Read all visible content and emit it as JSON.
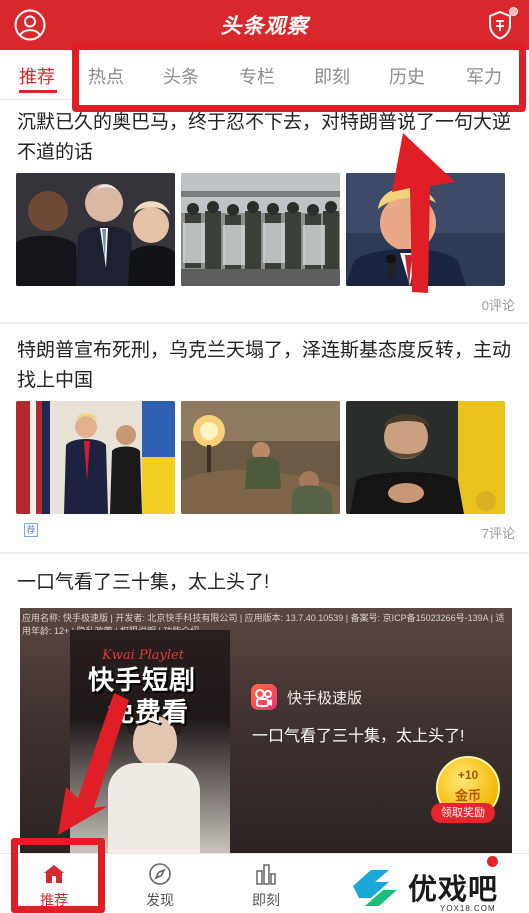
{
  "header": {
    "title": "头条观察",
    "avatar_icon": "user-icon",
    "shield_icon": "shield-icon"
  },
  "tabs": {
    "active": "推荐",
    "items": [
      "热点",
      "头条",
      "专栏",
      "即刻",
      "历史",
      "军力"
    ]
  },
  "articles": [
    {
      "title": "沉默已久的奥巴马，终于忍不下去，对特朗普说了一句大逆不道的话",
      "comments": "0评论"
    },
    {
      "title": "特朗普宣布死刑，乌克兰天塌了，泽连斯基态度反转，主动找上中国",
      "tag": "荐",
      "comments": "7评论"
    },
    {
      "title": "一口气看了三十集，太上头了!"
    }
  ],
  "ad": {
    "info": "应用名称: 快手极速版 | 开发者: 北京快手科技有限公司 | 应用版本: 13.7.40.10539 | 备案号: 京ICP备15023266号-139A | 适用年龄: 12+ | 隐私政策 | 权限说明 | 功能介绍",
    "poster_sub": "Kwai Playlet",
    "poster_title_1": "快手短剧",
    "poster_title_2": "免费看",
    "app_name": "快手极速版",
    "slogan": "一口气看了三十集，太上头了!",
    "coin_amount": "+10",
    "coin_unit": "金币",
    "coin_button": "领取奖励"
  },
  "bottom_nav": [
    {
      "label": "推荐",
      "icon": "home-icon",
      "active": true
    },
    {
      "label": "发现",
      "icon": "compass-icon"
    },
    {
      "label": "即刻",
      "icon": "bars-icon"
    }
  ],
  "watermark": {
    "text": "优戏吧",
    "domain": "YOX18.COM"
  },
  "colors": {
    "brand": "#d8282c",
    "highlight": "#e01e26",
    "tag_blue": "#5a86d6"
  }
}
